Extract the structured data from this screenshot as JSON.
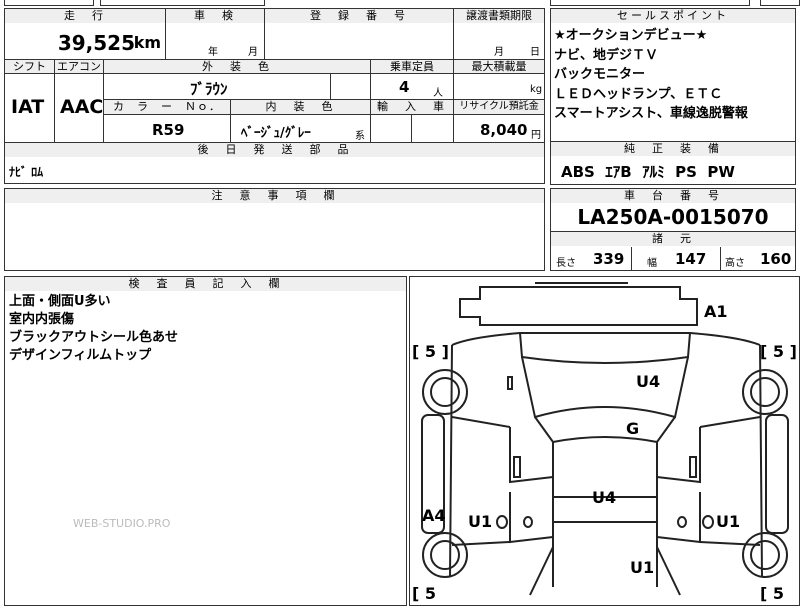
{
  "top_fragment": "",
  "mileage": {
    "header": "走　行",
    "value": "39,525",
    "unit": "km"
  },
  "inspection": {
    "header": "車　検",
    "year_label": "年",
    "month_label": "月",
    "value": ""
  },
  "registration": {
    "header": "登　録　番　号",
    "value": ""
  },
  "transfer": {
    "header": "譲渡書類期限",
    "month_label": "月",
    "day_label": "日"
  },
  "sales_points": {
    "header": "セールスポイント",
    "items": [
      "★オークションデビュー★",
      "ナビ、地デジＴＶ",
      "バックモニター",
      "ＬＥＤヘッドランプ、ＥＴＣ",
      "スマートアシスト、車線逸脱警報"
    ]
  },
  "shift": {
    "header": "シフト",
    "value": "IAT"
  },
  "aircon": {
    "header": "エアコン",
    "value": "AAC"
  },
  "exterior_color": {
    "header": "外　装　色",
    "value": "ﾌﾞﾗｳﾝ"
  },
  "capacity": {
    "header": "乗車定員",
    "value": "4",
    "unit": "人"
  },
  "max_load": {
    "header": "最大積載量",
    "unit": "kg"
  },
  "color_no": {
    "header": "カ　ラ　ー　Ｎｏ．",
    "value": "R59"
  },
  "interior_color": {
    "header": "内　装　色",
    "value": "ﾍﾞｰｼﾞｭ/ｸﾞﾚｰ",
    "suffix": "系"
  },
  "import": {
    "header": "輸　入　車"
  },
  "recycle": {
    "header": "リサイクル預託金",
    "value": "8,040",
    "unit": "円"
  },
  "later_parts": {
    "header": "後　日　発　送　部　品",
    "value": "ﾅﾋﾞ ﾛﾑ"
  },
  "equipment": {
    "header": "純　正　装　備",
    "value": "ABS  ｴｱB  ｱﾙﾐ  PS  PW"
  },
  "notes": {
    "header": "注　意　事　項　欄",
    "value": ""
  },
  "chassis": {
    "header": "車　台　番　号",
    "value": "LA250A-0015070"
  },
  "dims": {
    "header": "諸　元",
    "length_label": "長さ",
    "length": "339",
    "width_label": "幅",
    "width": "147",
    "height_label": "高さ",
    "height": "160"
  },
  "inspector": {
    "header": "検　査　員　記　入　欄",
    "lines": [
      "上面・側面U多い",
      "室内内張傷",
      "ブラックアウトシール色あせ",
      "デザインフィルムトップ"
    ]
  },
  "watermark": "WEB-STUDIO.PRO",
  "diagram": {
    "bracket_left_top": "[ 5 ]",
    "bracket_right_top": "[ 5 ]",
    "bracket_left_bottom": "[ 5",
    "bracket_right_bottom": "[ 5",
    "marks": {
      "a1": "A1",
      "u4_top": "U4",
      "g": "G",
      "u4_mid": "U4",
      "a4": "A4",
      "u1_left": "U1",
      "u1_right": "U1",
      "u1_bottom": "U1"
    }
  }
}
